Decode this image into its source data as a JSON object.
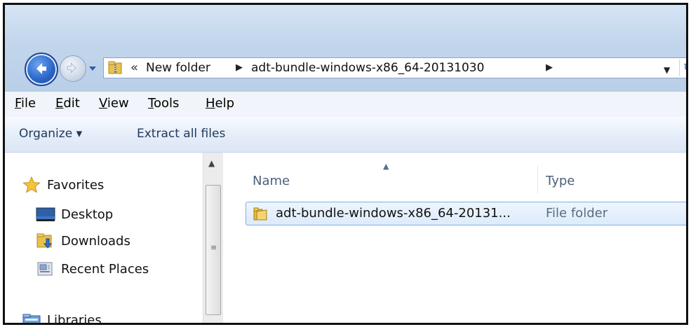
{
  "navigation": {
    "address_crumbs": [
      "New folder",
      "adt-bundle-windows-x86_64-20131030"
    ],
    "overflow_chevron": "«"
  },
  "menu": {
    "items": [
      {
        "label": "File",
        "accel": "F",
        "rest": "ile"
      },
      {
        "label": "Edit",
        "accel": "E",
        "rest": "dit"
      },
      {
        "label": "View",
        "accel": "V",
        "rest": "iew"
      },
      {
        "label": "Tools",
        "accel": "T",
        "rest": "ools"
      },
      {
        "label": "Help",
        "accel": "H",
        "rest": "elp"
      }
    ]
  },
  "commands": {
    "organize_label": "Organize ▾",
    "extract_label": "Extract all files"
  },
  "nav_pane": {
    "items": [
      {
        "label": "Favorites",
        "icon": "star-icon"
      },
      {
        "label": "Desktop",
        "icon": "desktop-icon"
      },
      {
        "label": "Downloads",
        "icon": "downloads-icon"
      },
      {
        "label": "Recent Places",
        "icon": "recent-places-icon"
      },
      {
        "label": "Libraries",
        "icon": "libraries-icon"
      }
    ]
  },
  "content": {
    "columns": {
      "name": "Name",
      "type": "Type"
    },
    "rows": [
      {
        "name": "adt-bundle-windows-x86_64-20131...",
        "type": "File folder",
        "selected": true
      }
    ]
  },
  "colors": {
    "chrome": "#c3d6ec",
    "selection": "#dcebfc",
    "selection_border": "#84acdd",
    "command_text": "#1e395b"
  }
}
